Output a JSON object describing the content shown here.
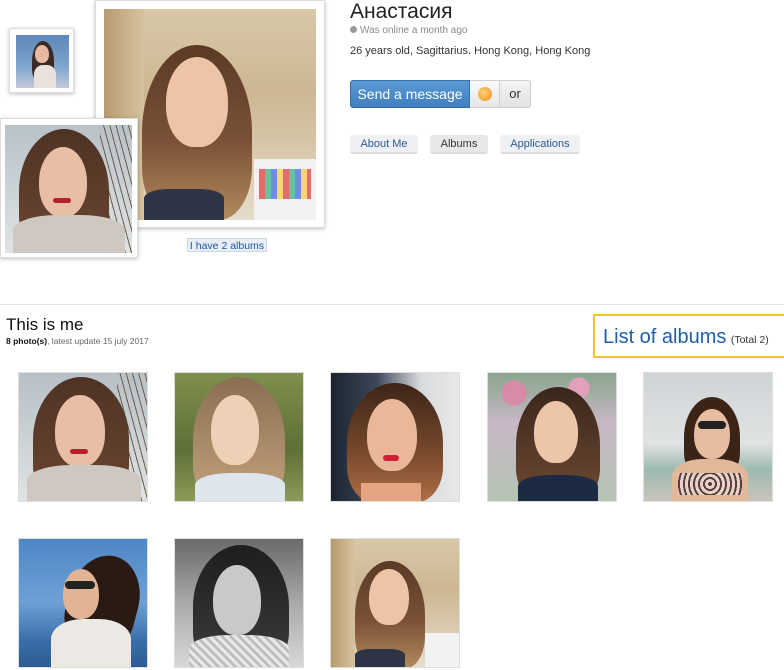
{
  "profile": {
    "name": "Анастасия",
    "online_status": "Was online a month ago",
    "info": "26 years old, Sagittarius. Hong Kong, Hong Kong"
  },
  "actions": {
    "send_message": "Send a message",
    "or_label": "or"
  },
  "tabs": [
    {
      "label": "About Me"
    },
    {
      "label": "Albums"
    },
    {
      "label": "Applications"
    }
  ],
  "albums_link": "I have 2 albums",
  "section": {
    "title": "This is me",
    "photo_count": "8 photo(s)",
    "meta_suffix": ", latest update 15 july 2017"
  },
  "list_albums": {
    "label": "List of albums",
    "total": "(Total 2)"
  },
  "colors": {
    "primary_button": "#4a8bcc",
    "link": "#1f5ea8",
    "highlight_border": "#f0c52c"
  },
  "photos": [
    {
      "alt": "photo-1"
    },
    {
      "alt": "photo-2"
    },
    {
      "alt": "photo-3"
    },
    {
      "alt": "photo-4"
    },
    {
      "alt": "photo-5"
    },
    {
      "alt": "photo-6"
    },
    {
      "alt": "photo-7"
    },
    {
      "alt": "photo-8"
    }
  ]
}
